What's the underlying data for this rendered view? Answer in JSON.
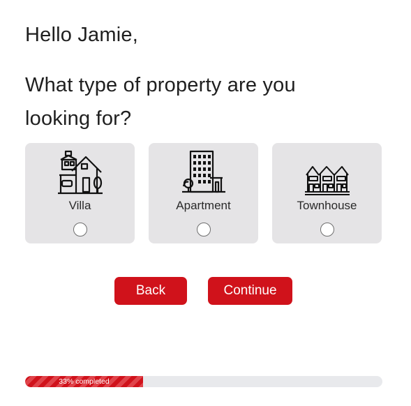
{
  "greeting": "Hello Jamie,",
  "question": "What type of property are you looking for?",
  "options": [
    {
      "label": "Villa",
      "icon": "villa-icon",
      "selected": false
    },
    {
      "label": "Apartment",
      "icon": "apartment-icon",
      "selected": false
    },
    {
      "label": "Townhouse",
      "icon": "townhouse-icon",
      "selected": false
    }
  ],
  "buttons": {
    "back": "Back",
    "continue": "Continue"
  },
  "progress": {
    "percent": 33,
    "label": "33% completed"
  },
  "colors": {
    "accent": "#d0121b",
    "card_background": "#e5e4e6",
    "progress_track": "#e8e9ec"
  }
}
